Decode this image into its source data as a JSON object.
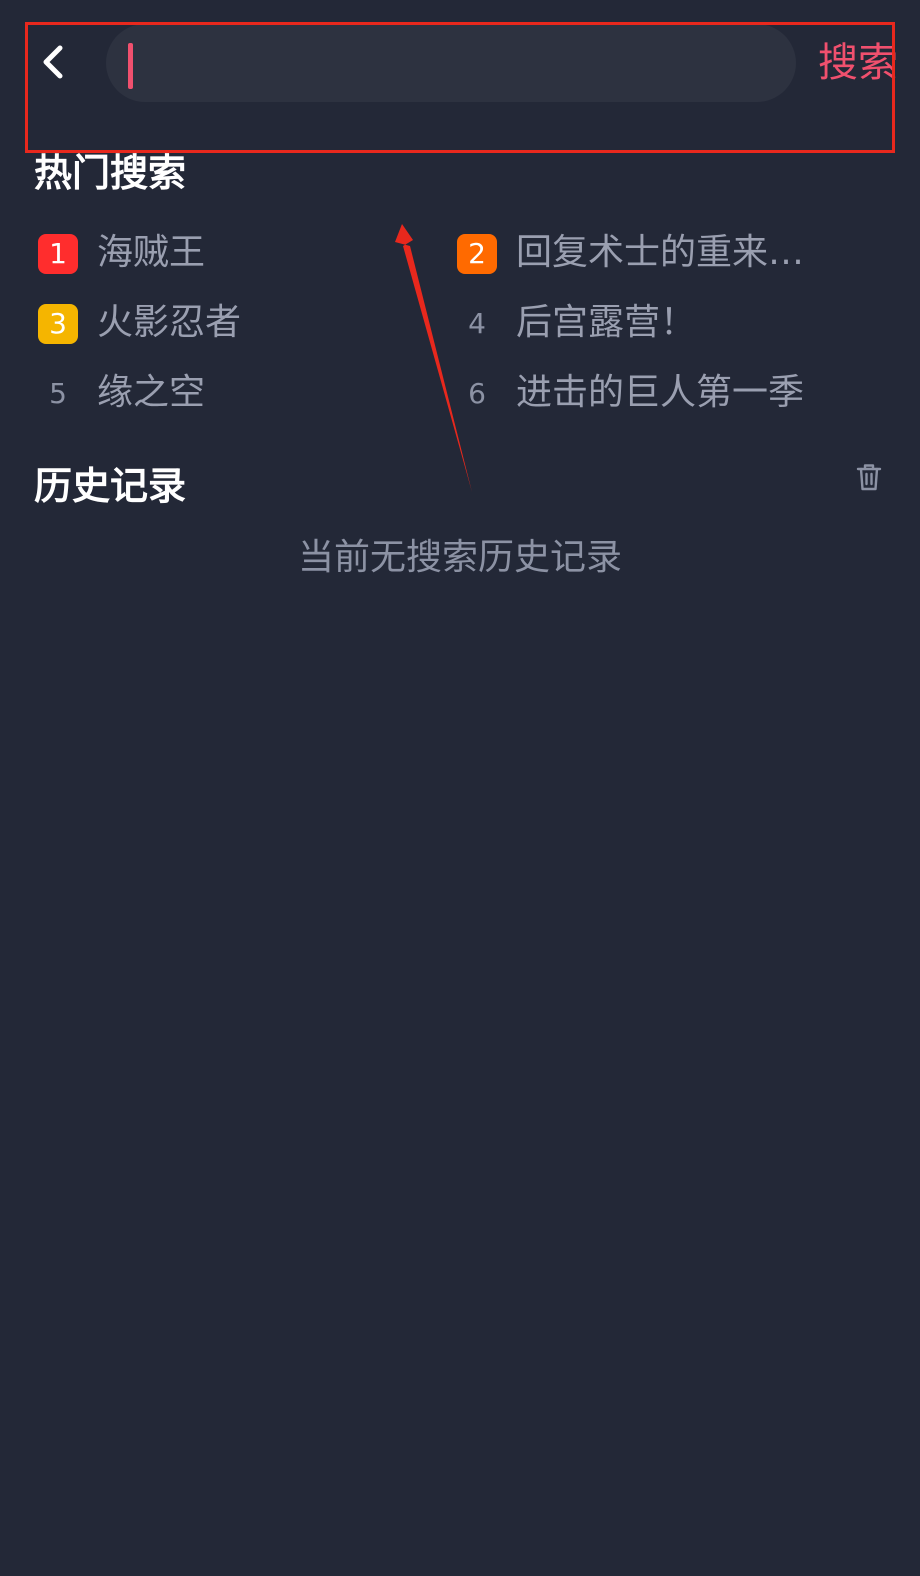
{
  "header": {
    "search_value": "",
    "search_button_label": "搜索"
  },
  "hot": {
    "title": "热门搜索",
    "items": [
      {
        "rank": "1",
        "label": "海贼王",
        "badge_color": "#ff2d2d"
      },
      {
        "rank": "2",
        "label": "回复术士的重来…",
        "badge_color": "#ff6a00"
      },
      {
        "rank": "3",
        "label": "火影忍者",
        "badge_color": "#f5b500"
      },
      {
        "rank": "4",
        "label": "后宫露营！"
      },
      {
        "rank": "5",
        "label": "缘之空"
      },
      {
        "rank": "6",
        "label": "进击的巨人第一季"
      }
    ]
  },
  "history": {
    "title": "历史记录",
    "empty_message": "当前无搜索历史记录"
  },
  "colors": {
    "background": "#232837",
    "search_box": "#2d3240",
    "accent": "#f0506e",
    "annotation": "#e8281d"
  },
  "icons": {
    "back": "chevron-left-icon",
    "delete": "trash-icon"
  }
}
